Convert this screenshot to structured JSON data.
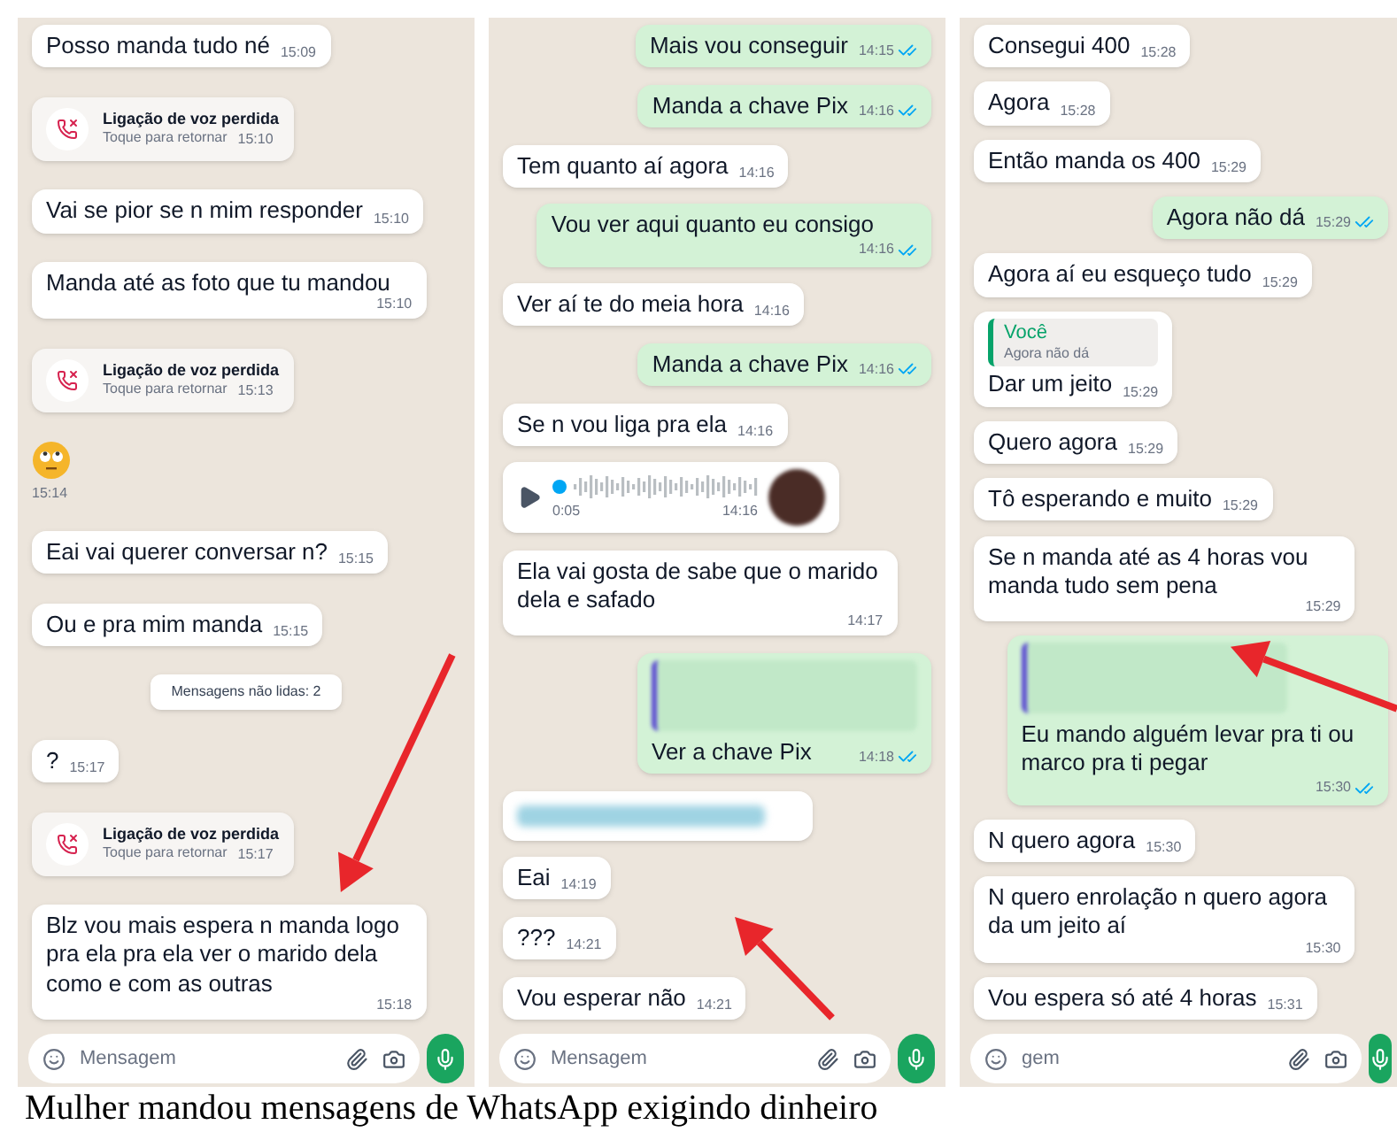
{
  "panels": [
    {
      "messages": [
        {
          "kind": "in",
          "text": "Posso manda tudo né",
          "time": "15:09"
        },
        {
          "kind": "missed_call",
          "title": "Ligação de voz perdida",
          "subtitle": "Toque para retornar",
          "time": "15:10"
        },
        {
          "kind": "in",
          "text": "Vai se pior se n mim responder",
          "time": "15:10"
        },
        {
          "kind": "in",
          "text": "Manda até as foto que tu mandou",
          "time": "15:10"
        },
        {
          "kind": "missed_call",
          "title": "Ligação de voz perdida",
          "subtitle": "Toque para retornar",
          "time": "15:13"
        },
        {
          "kind": "emoji",
          "time": "15:14"
        },
        {
          "kind": "in",
          "text": "Eai vai querer conversar n?",
          "time": "15:15"
        },
        {
          "kind": "in",
          "text": "Ou e pra mim manda",
          "time": "15:15"
        },
        {
          "kind": "system",
          "text": "Mensagens não lidas: 2"
        },
        {
          "kind": "in",
          "text": "?",
          "time": "15:17"
        },
        {
          "kind": "missed_call",
          "title": "Ligação de voz perdida",
          "subtitle": "Toque para retornar",
          "time": "15:17"
        },
        {
          "kind": "in",
          "text": "Blz vou mais espera n manda logo pra ela pra ela ver o marido dela como e com as outras",
          "time": "15:18"
        }
      ],
      "composer": {
        "placeholder": "Mensagem"
      }
    },
    {
      "messages": [
        {
          "kind": "out",
          "text": "Mais vou conseguir",
          "time": "14:15",
          "read": true
        },
        {
          "kind": "out",
          "text": "Manda a chave Pix",
          "time": "14:16",
          "read": true
        },
        {
          "kind": "in",
          "text": "Tem quanto aí agora",
          "time": "14:16"
        },
        {
          "kind": "out",
          "text": "Vou ver aqui quanto eu consigo",
          "time": "14:16",
          "read": true
        },
        {
          "kind": "in",
          "text": "Ver aí te do meia hora",
          "time": "14:16"
        },
        {
          "kind": "out",
          "text": "Manda a chave Pix",
          "time": "14:16",
          "read": true
        },
        {
          "kind": "in",
          "text": "Se n vou liga pra ela",
          "time": "14:16"
        },
        {
          "kind": "audio",
          "duration": "0:05",
          "time": "14:16"
        },
        {
          "kind": "in",
          "text": "Ela vai gosta de sabe que o marido dela e safado",
          "time": "14:17"
        },
        {
          "kind": "out",
          "text": "Ver a chave Pix",
          "time": "14:18",
          "read": true,
          "quote_blurred": true
        },
        {
          "kind": "blurred"
        },
        {
          "kind": "in",
          "text": "Eai",
          "time": "14:19"
        },
        {
          "kind": "in",
          "text": "???",
          "time": "14:21"
        },
        {
          "kind": "in",
          "text": "Vou esperar não",
          "time": "14:21"
        }
      ],
      "composer": {
        "placeholder": "Mensagem"
      }
    },
    {
      "messages": [
        {
          "kind": "in",
          "text": "Consegui 400",
          "time": "15:28"
        },
        {
          "kind": "in",
          "text": "Agora",
          "time": "15:28"
        },
        {
          "kind": "in",
          "text": "Então manda os 400",
          "time": "15:29"
        },
        {
          "kind": "out",
          "text": "Agora não dá",
          "time": "15:29",
          "read": true
        },
        {
          "kind": "in",
          "text": "Agora aí eu esqueço tudo",
          "time": "15:29"
        },
        {
          "kind": "in",
          "text": "Dar um jeito",
          "time": "15:29",
          "quote": {
            "author": "Você",
            "text": "Agora não dá"
          }
        },
        {
          "kind": "in",
          "text": "Quero agora",
          "time": "15:29"
        },
        {
          "kind": "in",
          "text": "Tô esperando e muito",
          "time": "15:29"
        },
        {
          "kind": "in",
          "text": "Se n manda até as 4 horas vou manda tudo sem pena",
          "time": "15:29"
        },
        {
          "kind": "out",
          "text": "Eu mando alguém levar pra ti ou marco pra ti pegar",
          "time": "15:30",
          "read": true,
          "quote_blurred": true
        },
        {
          "kind": "in",
          "text": "N quero agora",
          "time": "15:30"
        },
        {
          "kind": "in",
          "text": "N quero enrolação n quero agora da um jeito aí",
          "time": "15:30"
        },
        {
          "kind": "in",
          "text": "Vou espera só até 4 horas",
          "time": "15:31"
        }
      ],
      "composer": {
        "placeholder": "gem"
      }
    }
  ],
  "caption": "Mulher mandou mensagens de WhatsApp exigindo dinheiro"
}
